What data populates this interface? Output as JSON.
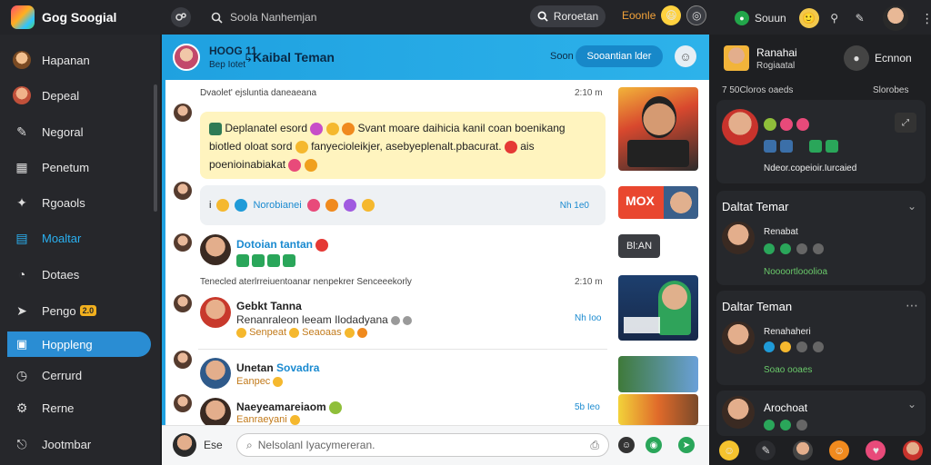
{
  "topbar": {
    "brand": "Gog Soogial",
    "search_placeholder": "Soola Nanhemjan",
    "search_button": "Roroetan",
    "right_label_1": "Eoonle",
    "right_label_2": "Souun"
  },
  "sidebar": {
    "items": [
      {
        "label": "Hapanan",
        "icon": "avatar-icon"
      },
      {
        "label": "Depeal",
        "icon": "avatar-icon"
      },
      {
        "label": "Negoral",
        "icon": "pencil-icon"
      },
      {
        "label": "Penetum",
        "icon": "grid-icon"
      },
      {
        "label": "Rgoaols",
        "icon": "puzzle-icon"
      },
      {
        "label": "Moaltar",
        "icon": "chart-icon"
      },
      {
        "label": "Dotaes",
        "icon": "chat-icon"
      },
      {
        "label": "Pengo",
        "icon": "send-icon",
        "badge": "2.0"
      },
      {
        "label": "Hoppleng",
        "icon": "image-icon"
      },
      {
        "label": "Cerrurd",
        "icon": "clock-icon"
      },
      {
        "label": "Rerne",
        "icon": "bell-icon"
      },
      {
        "label": "Jootmbar",
        "icon": "exit-icon"
      }
    ]
  },
  "chat": {
    "header": {
      "name": "HOOG 11",
      "sub": "Bep Iotet",
      "title": "Kaibal Teman",
      "soon": "Soon",
      "button": "Sooantian lder"
    },
    "meta_1": "Dvaolet' ejsluntia daneaeana",
    "time_1": "2:10 m",
    "bubble_1": {
      "line_1": "Deplanatel esord",
      "line_1b": "Svant moare daihicia kanil coan boenikang",
      "line_2": "biotled oloat sord",
      "line_2b": "fanyecioleikjer, asebyeplenalt.pbacurat.",
      "line_2c": "ais",
      "line_3": "poenioinabiakat"
    },
    "bubble_2": {
      "prefix": "i",
      "text": "Norobianei",
      "time": "Nh 1e0"
    },
    "msg_3": {
      "name": "Dotoian tantan",
      "badge_label": "Bl:AN"
    },
    "meta_2": "Tenecled aterlrreiuentoanar nenpekrer Senceeekorly",
    "time_2": "2:10 m",
    "msg_4": {
      "name": "Gebkt Tanna",
      "text": "Renanraleon leeam Ilodadyana",
      "sub_1": "Senpeat",
      "sub_2": "Seaoaas",
      "time": "Nh Ioo"
    },
    "msg_5": {
      "name": "Unetan",
      "name_b": "Sovadra",
      "sub": "Eanpec"
    },
    "msg_6": {
      "name": "Naeyeamareiaom",
      "sub": "Eanraeyani",
      "time": "5b Ieo"
    },
    "thumb_2_label": "MOX",
    "compose": {
      "left": "Ese",
      "placeholder": "Nelsolanl Iyacymereran."
    }
  },
  "right": {
    "profile": {
      "name": "Ranahai",
      "sub": "Rogiaatal",
      "button": "Ecnnon"
    },
    "feed_meta": "7 50Cloros oaeds",
    "feed_right": "Slorobes",
    "feed_caption": "Ndeor.copeioir.Iurcaied",
    "friends_1_title": "Daltat Temar",
    "friends_1_name": "Renabat",
    "friends_1_sub": "Noooortlooolioa",
    "friends_2_title": "Daltar Teman",
    "friends_2_name": "Renahaheri",
    "friends_2_sub": "Soao ooaes",
    "friends_3_name": "Arochoat"
  }
}
